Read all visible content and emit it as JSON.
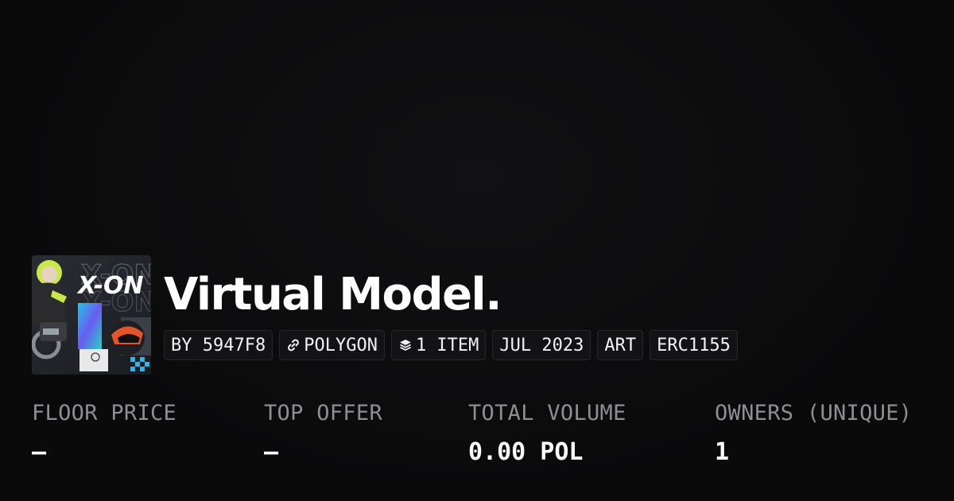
{
  "collection": {
    "title": "Virtual Model.",
    "image_alt": "collection-thumbnail",
    "thumbnail_text": "X-ON"
  },
  "chips": [
    {
      "label": "BY 5947F8",
      "icon": ""
    },
    {
      "label": "POLYGON",
      "icon": "link-icon"
    },
    {
      "label": "1 ITEM",
      "icon": "layers-icon"
    },
    {
      "label": "JUL 2023",
      "icon": ""
    },
    {
      "label": "ART",
      "icon": ""
    },
    {
      "label": "ERC1155",
      "icon": ""
    }
  ],
  "stats": [
    {
      "label": "FLOOR PRICE",
      "value": "—"
    },
    {
      "label": "TOP OFFER",
      "value": "—"
    },
    {
      "label": "TOTAL VOLUME",
      "value": "0.00 POL"
    },
    {
      "label": "OWNERS (UNIQUE)",
      "value": "1"
    }
  ],
  "colors": {
    "background": "#0b0b0c",
    "text": "#ffffff",
    "muted": "#8e8e93",
    "chip_bg": "#131315",
    "chip_border": "#27272a"
  }
}
